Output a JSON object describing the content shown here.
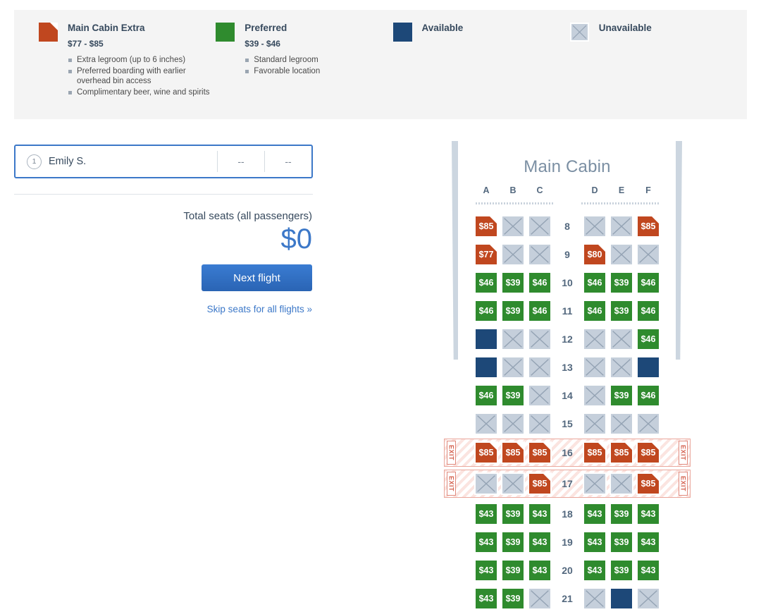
{
  "legend": {
    "items": [
      {
        "title": "Main Cabin Extra",
        "price": "$77 - $85",
        "swatch": "mce",
        "icon": "main-cabin-extra-swatch-icon",
        "features": [
          "Extra legroom (up to 6 inches)",
          "Preferred boarding with earlier overhead bin access",
          "Complimentary beer, wine and spirits"
        ]
      },
      {
        "title": "Preferred",
        "price": "$39 - $46",
        "swatch": "pref",
        "icon": "preferred-swatch-icon",
        "features": [
          "Standard legroom",
          "Favorable location"
        ]
      },
      {
        "title": "Available",
        "price": "",
        "swatch": "avail",
        "icon": "available-swatch-icon",
        "features": []
      },
      {
        "title": "Unavailable",
        "price": "",
        "swatch": "unavail",
        "icon": "unavailable-swatch-icon",
        "features": []
      }
    ]
  },
  "passengers": [
    {
      "number": "1",
      "name": "Emily S.",
      "col1": "--",
      "col2": "--"
    }
  ],
  "totals": {
    "label": "Total seats (all passengers)",
    "amount": "$0"
  },
  "actions": {
    "next_flight": "Next flight",
    "skip_seats": "Skip seats for all flights »"
  },
  "seatmap": {
    "cabin_title": "Main Cabin",
    "columns_left": [
      "A",
      "B",
      "C"
    ],
    "columns_right": [
      "D",
      "E",
      "F"
    ],
    "exit_label": "EXIT",
    "colors": {
      "main_cabin_extra": "#c0471f",
      "preferred": "#2f8b2e",
      "available": "#1d4878",
      "unavailable": "#c5cfdb",
      "accent": "#3c78c8",
      "exit_stripe": "#eaa79c"
    },
    "rows": [
      {
        "number": "8",
        "exit": false,
        "left": [
          {
            "type": "mce",
            "price": "$85"
          },
          {
            "type": "unavail",
            "price": ""
          },
          {
            "type": "unavail",
            "price": ""
          }
        ],
        "right": [
          {
            "type": "unavail",
            "price": ""
          },
          {
            "type": "unavail",
            "price": ""
          },
          {
            "type": "mce",
            "price": "$85"
          }
        ]
      },
      {
        "number": "9",
        "exit": false,
        "left": [
          {
            "type": "mce",
            "price": "$77"
          },
          {
            "type": "unavail",
            "price": ""
          },
          {
            "type": "unavail",
            "price": ""
          }
        ],
        "right": [
          {
            "type": "mce",
            "price": "$80"
          },
          {
            "type": "unavail",
            "price": ""
          },
          {
            "type": "unavail",
            "price": ""
          }
        ]
      },
      {
        "number": "10",
        "exit": false,
        "left": [
          {
            "type": "pref",
            "price": "$46"
          },
          {
            "type": "pref",
            "price": "$39"
          },
          {
            "type": "pref",
            "price": "$46"
          }
        ],
        "right": [
          {
            "type": "pref",
            "price": "$46"
          },
          {
            "type": "pref",
            "price": "$39"
          },
          {
            "type": "pref",
            "price": "$46"
          }
        ]
      },
      {
        "number": "11",
        "exit": false,
        "left": [
          {
            "type": "pref",
            "price": "$46"
          },
          {
            "type": "pref",
            "price": "$39"
          },
          {
            "type": "pref",
            "price": "$46"
          }
        ],
        "right": [
          {
            "type": "pref",
            "price": "$46"
          },
          {
            "type": "pref",
            "price": "$39"
          },
          {
            "type": "pref",
            "price": "$46"
          }
        ]
      },
      {
        "number": "12",
        "exit": false,
        "left": [
          {
            "type": "avail",
            "price": ""
          },
          {
            "type": "unavail",
            "price": ""
          },
          {
            "type": "unavail",
            "price": ""
          }
        ],
        "right": [
          {
            "type": "unavail",
            "price": ""
          },
          {
            "type": "unavail",
            "price": ""
          },
          {
            "type": "pref",
            "price": "$46"
          }
        ]
      },
      {
        "number": "13",
        "exit": false,
        "left": [
          {
            "type": "avail",
            "price": ""
          },
          {
            "type": "unavail",
            "price": ""
          },
          {
            "type": "unavail",
            "price": ""
          }
        ],
        "right": [
          {
            "type": "unavail",
            "price": ""
          },
          {
            "type": "unavail",
            "price": ""
          },
          {
            "type": "avail",
            "price": ""
          }
        ]
      },
      {
        "number": "14",
        "exit": false,
        "left": [
          {
            "type": "pref",
            "price": "$46"
          },
          {
            "type": "pref",
            "price": "$39"
          },
          {
            "type": "unavail",
            "price": ""
          }
        ],
        "right": [
          {
            "type": "unavail",
            "price": ""
          },
          {
            "type": "pref",
            "price": "$39"
          },
          {
            "type": "pref",
            "price": "$46"
          }
        ]
      },
      {
        "number": "15",
        "exit": false,
        "left": [
          {
            "type": "unavail",
            "price": ""
          },
          {
            "type": "unavail",
            "price": ""
          },
          {
            "type": "unavail",
            "price": ""
          }
        ],
        "right": [
          {
            "type": "unavail",
            "price": ""
          },
          {
            "type": "unavail",
            "price": ""
          },
          {
            "type": "unavail",
            "price": ""
          }
        ]
      },
      {
        "number": "16",
        "exit": true,
        "left": [
          {
            "type": "mce",
            "price": "$85"
          },
          {
            "type": "mce",
            "price": "$85"
          },
          {
            "type": "mce",
            "price": "$85"
          }
        ],
        "right": [
          {
            "type": "mce",
            "price": "$85"
          },
          {
            "type": "mce",
            "price": "$85"
          },
          {
            "type": "mce",
            "price": "$85"
          }
        ]
      },
      {
        "number": "17",
        "exit": true,
        "left": [
          {
            "type": "unavail",
            "price": ""
          },
          {
            "type": "unavail",
            "price": ""
          },
          {
            "type": "mce",
            "price": "$85"
          }
        ],
        "right": [
          {
            "type": "unavail",
            "price": ""
          },
          {
            "type": "unavail",
            "price": ""
          },
          {
            "type": "mce",
            "price": "$85"
          }
        ]
      },
      {
        "number": "18",
        "exit": false,
        "left": [
          {
            "type": "pref",
            "price": "$43"
          },
          {
            "type": "pref",
            "price": "$39"
          },
          {
            "type": "pref",
            "price": "$43"
          }
        ],
        "right": [
          {
            "type": "pref",
            "price": "$43"
          },
          {
            "type": "pref",
            "price": "$39"
          },
          {
            "type": "pref",
            "price": "$43"
          }
        ]
      },
      {
        "number": "19",
        "exit": false,
        "left": [
          {
            "type": "pref",
            "price": "$43"
          },
          {
            "type": "pref",
            "price": "$39"
          },
          {
            "type": "pref",
            "price": "$43"
          }
        ],
        "right": [
          {
            "type": "pref",
            "price": "$43"
          },
          {
            "type": "pref",
            "price": "$39"
          },
          {
            "type": "pref",
            "price": "$43"
          }
        ]
      },
      {
        "number": "20",
        "exit": false,
        "left": [
          {
            "type": "pref",
            "price": "$43"
          },
          {
            "type": "pref",
            "price": "$39"
          },
          {
            "type": "pref",
            "price": "$43"
          }
        ],
        "right": [
          {
            "type": "pref",
            "price": "$43"
          },
          {
            "type": "pref",
            "price": "$39"
          },
          {
            "type": "pref",
            "price": "$43"
          }
        ]
      },
      {
        "number": "21",
        "exit": false,
        "left": [
          {
            "type": "pref",
            "price": "$43"
          },
          {
            "type": "pref",
            "price": "$39"
          },
          {
            "type": "unavail",
            "price": ""
          }
        ],
        "right": [
          {
            "type": "unavail",
            "price": ""
          },
          {
            "type": "avail",
            "price": ""
          },
          {
            "type": "unavail",
            "price": ""
          }
        ]
      }
    ]
  }
}
